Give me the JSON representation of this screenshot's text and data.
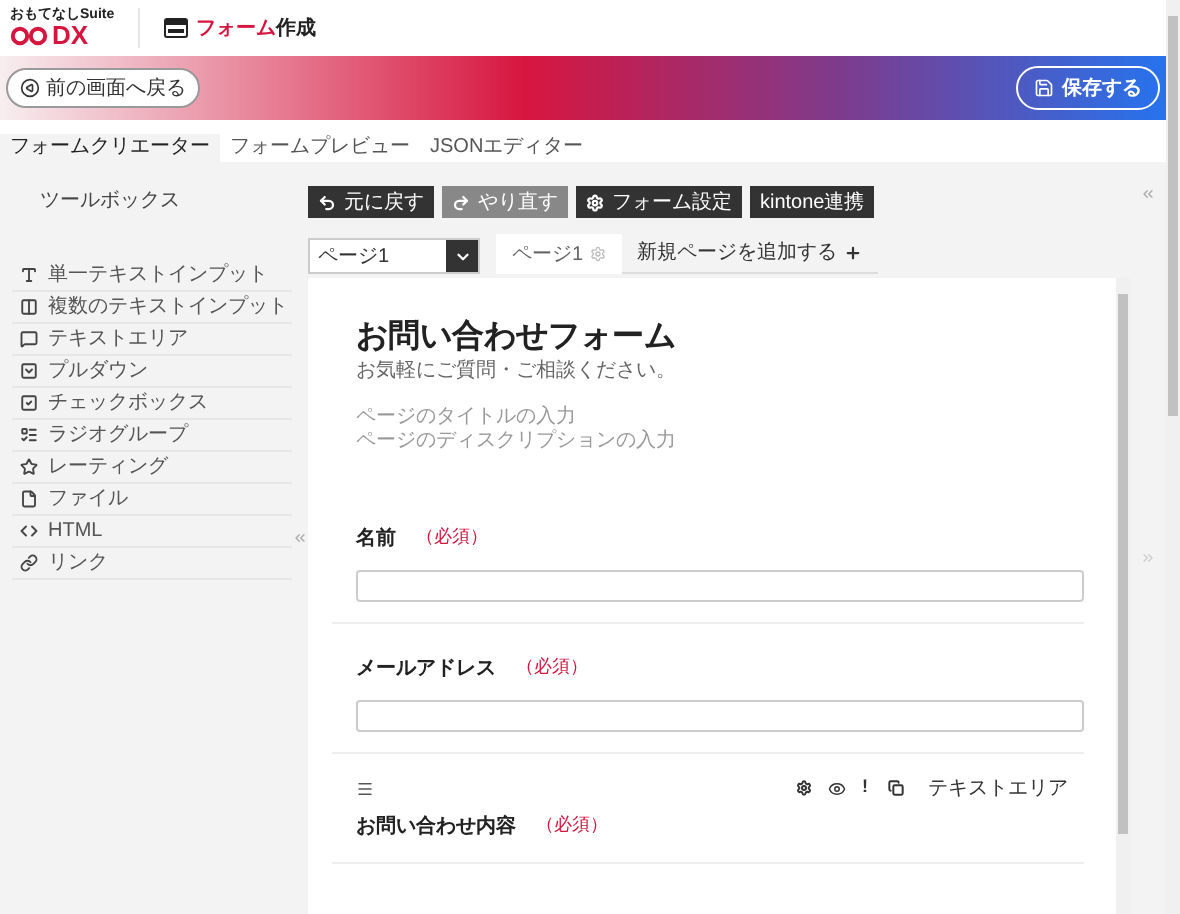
{
  "header": {
    "logo": {
      "tagline": "おもてなしSuite",
      "mark": "DX"
    },
    "title_parts": [
      {
        "text": "フォーム",
        "accent": true
      },
      {
        "text": "作成",
        "accent": false
      }
    ]
  },
  "banner": {
    "back_button": "前の画面へ戻る",
    "save_button": "保存する"
  },
  "tabs": [
    {
      "label": "フォームクリエーター",
      "selected": true
    },
    {
      "label": "フォームプレビュー",
      "selected": false
    },
    {
      "label": "JSONエディター",
      "selected": false
    }
  ],
  "toolbox": {
    "title": "ツールボックス",
    "items": [
      {
        "label": "単一テキストインプット",
        "kind": "text"
      },
      {
        "label": "複数のテキストインプット",
        "kind": "multi"
      },
      {
        "label": "テキストエリア",
        "kind": "textarea"
      },
      {
        "label": "プルダウン",
        "kind": "dropdown"
      },
      {
        "label": "チェックボックス",
        "kind": "checkbox"
      },
      {
        "label": "ラジオグループ",
        "kind": "radio"
      },
      {
        "label": "レーティング",
        "kind": "rating"
      },
      {
        "label": "ファイル",
        "kind": "file"
      },
      {
        "label": "HTML",
        "kind": "html"
      },
      {
        "label": "リンク",
        "kind": "link"
      }
    ]
  },
  "toolbar": [
    {
      "label": "元に戻す",
      "kind": "undo",
      "disabled": false
    },
    {
      "label": "やり直す",
      "kind": "redo",
      "disabled": true
    },
    {
      "label": "フォーム設定",
      "kind": "settings",
      "disabled": false
    },
    {
      "label": "kintone連携",
      "kind": "integration",
      "disabled": false
    }
  ],
  "page_select": {
    "value": "ページ1"
  },
  "page_tabs": [
    {
      "label": "ページ1",
      "selected": true,
      "kind": "page"
    },
    {
      "label": "新規ページを追加する",
      "selected": false,
      "kind": "add"
    }
  ],
  "form": {
    "title": "お問い合わせフォーム",
    "description": "お気軽にご質問・ご相談ください。",
    "hints": [
      "ページのタイトルの入力",
      "ページのディスクリプションの入力"
    ],
    "questions": [
      {
        "label": "名前",
        "required": "（必須）",
        "selected": false
      },
      {
        "label": "メールアドレス",
        "required": "（必須）",
        "selected": false
      },
      {
        "label": "お問い合わせ内容",
        "required": "（必須）",
        "selected": true,
        "required_toggle": "!",
        "type_label": "テキストエリア"
      }
    ]
  }
}
